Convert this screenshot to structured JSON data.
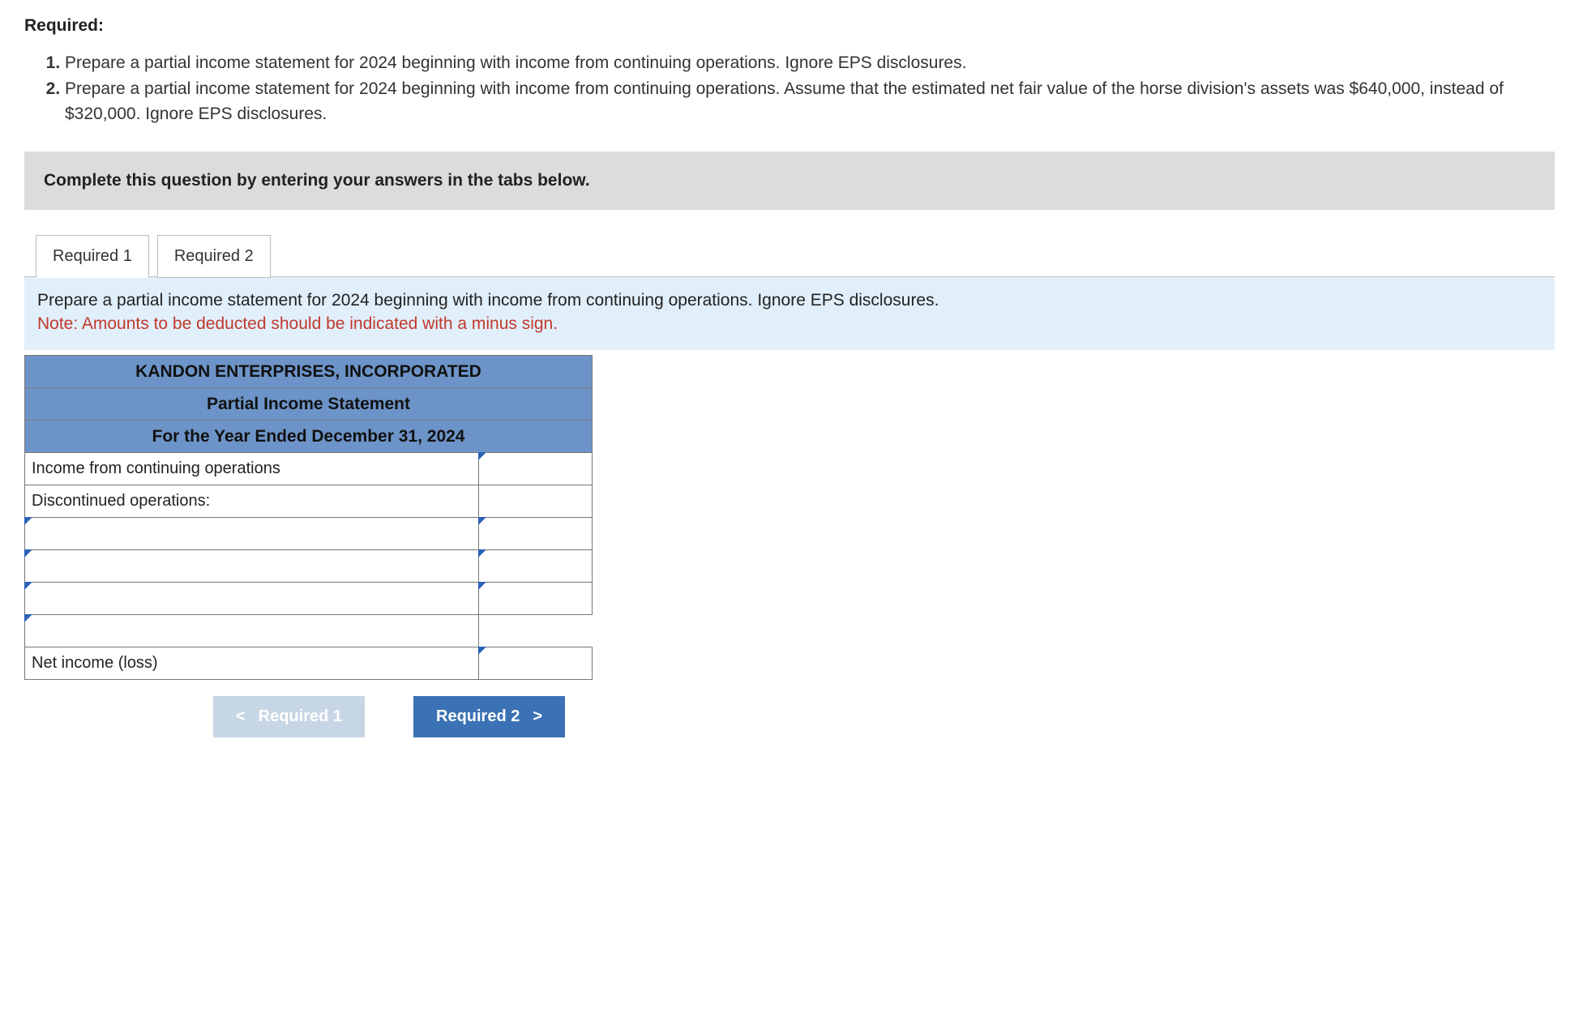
{
  "heading": "Required:",
  "requirements": [
    "Prepare a partial income statement for 2024 beginning with income from continuing operations. Ignore EPS disclosures.",
    "Prepare a partial income statement for 2024 beginning with income from continuing operations. Assume that the estimated net fair value of the horse division's assets was $640,000, instead of $320,000. Ignore EPS disclosures."
  ],
  "instruction_bar": "Complete this question by entering your answers in the tabs below.",
  "tabs": [
    {
      "label": "Required 1",
      "active": true
    },
    {
      "label": "Required 2",
      "active": false
    }
  ],
  "tab_panel": {
    "instruction": "Prepare a partial income statement for 2024 beginning with income from continuing operations. Ignore EPS disclosures.",
    "note": "Note: Amounts to be deducted should be indicated with a minus sign."
  },
  "statement": {
    "company": "KANDON ENTERPRISES, INCORPORATED",
    "title": "Partial Income Statement",
    "period": "For the Year Ended December 31, 2024",
    "rows": [
      {
        "label": "Income from continuing operations",
        "editable_label": false,
        "editable_val": true,
        "show_val": true
      },
      {
        "label": "Discontinued operations:",
        "editable_label": false,
        "editable_val": false,
        "show_val": true
      },
      {
        "label": "",
        "editable_label": true,
        "editable_val": true,
        "show_val": true
      },
      {
        "label": "",
        "editable_label": true,
        "editable_val": true,
        "show_val": true
      },
      {
        "label": "",
        "editable_label": true,
        "editable_val": true,
        "show_val": true
      },
      {
        "label": "",
        "editable_label": true,
        "editable_val": false,
        "show_val": false
      },
      {
        "label": "Net income (loss)",
        "editable_label": false,
        "editable_val": true,
        "show_val": true
      }
    ]
  },
  "nav": {
    "prev": {
      "label": "Required 1",
      "chev": "<",
      "enabled": false
    },
    "next": {
      "label": "Required 2",
      "chev": ">",
      "enabled": true
    }
  }
}
